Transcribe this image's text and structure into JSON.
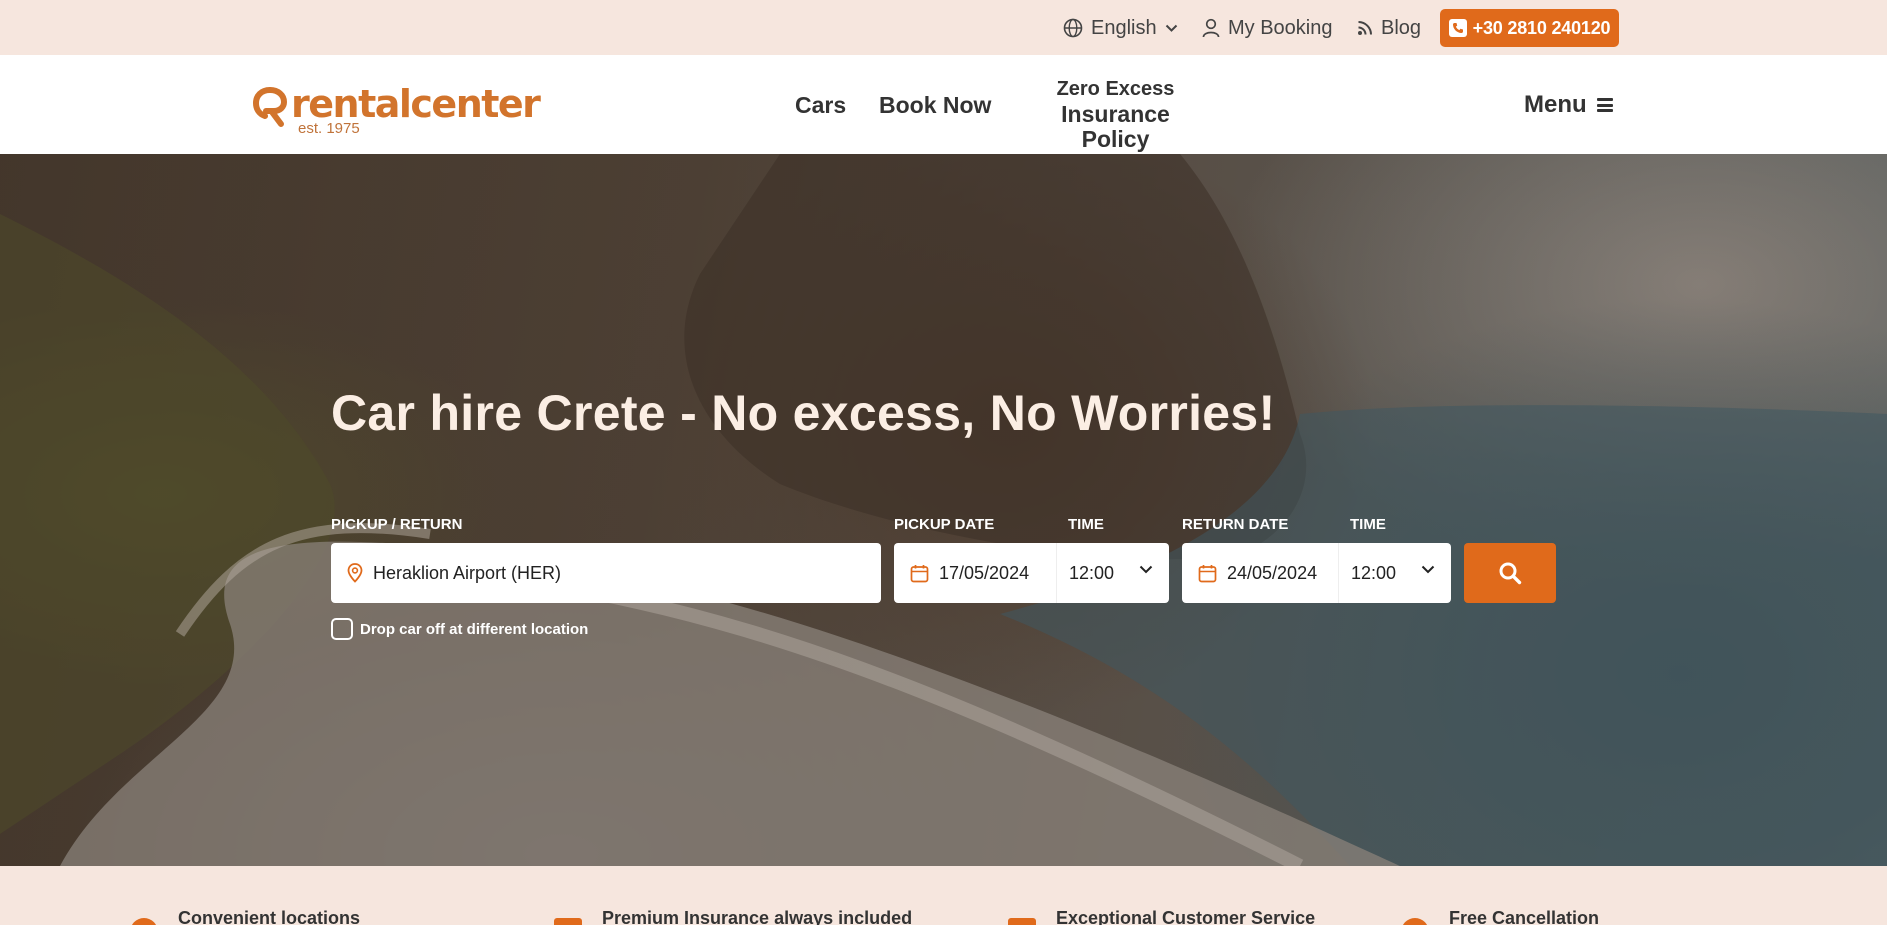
{
  "topbar": {
    "language": "English",
    "my_booking": "My Booking",
    "blog": "Blog",
    "phone": "+30 2810 240120"
  },
  "header": {
    "logo_word": "rentalcenter",
    "logo_est": "est. 1975",
    "nav": {
      "cars": "Cars",
      "book_now": "Book Now",
      "zero_excess_line1": "Zero Excess",
      "zero_excess_line2": "Insurance Policy"
    },
    "menu_label": "Menu"
  },
  "hero": {
    "title": "Car hire Crete - No excess, No Worries!",
    "form": {
      "pickup_return_label": "PICKUP / RETURN",
      "pickup_return_value": "Heraklion Airport (HER)",
      "pickup_date_label": "PICKUP DATE",
      "pickup_date_value": "17/05/2024",
      "pickup_time_label": "TIME",
      "pickup_time_value": "12:00",
      "return_date_label": "RETURN DATE",
      "return_date_value": "24/05/2024",
      "return_time_label": "TIME",
      "return_time_value": "12:00",
      "dropoff_label": "Drop car off at different location",
      "dropoff_checked": false
    }
  },
  "features": [
    "Convenient locations",
    "Premium Insurance always included",
    "Exceptional Customer Service",
    "Free Cancellation"
  ],
  "colors": {
    "accent": "#e06a1b",
    "topbar_bg": "#f6e6de",
    "logo": "#d2742c"
  },
  "icons": {
    "language": "globe-icon",
    "my_booking": "user-icon",
    "blog": "rss-icon",
    "phone": "phone-icon",
    "location": "map-pin-icon",
    "date": "calendar-icon",
    "time": "chevron-down-icon",
    "search": "search-icon",
    "menu": "hamburger-icon"
  }
}
